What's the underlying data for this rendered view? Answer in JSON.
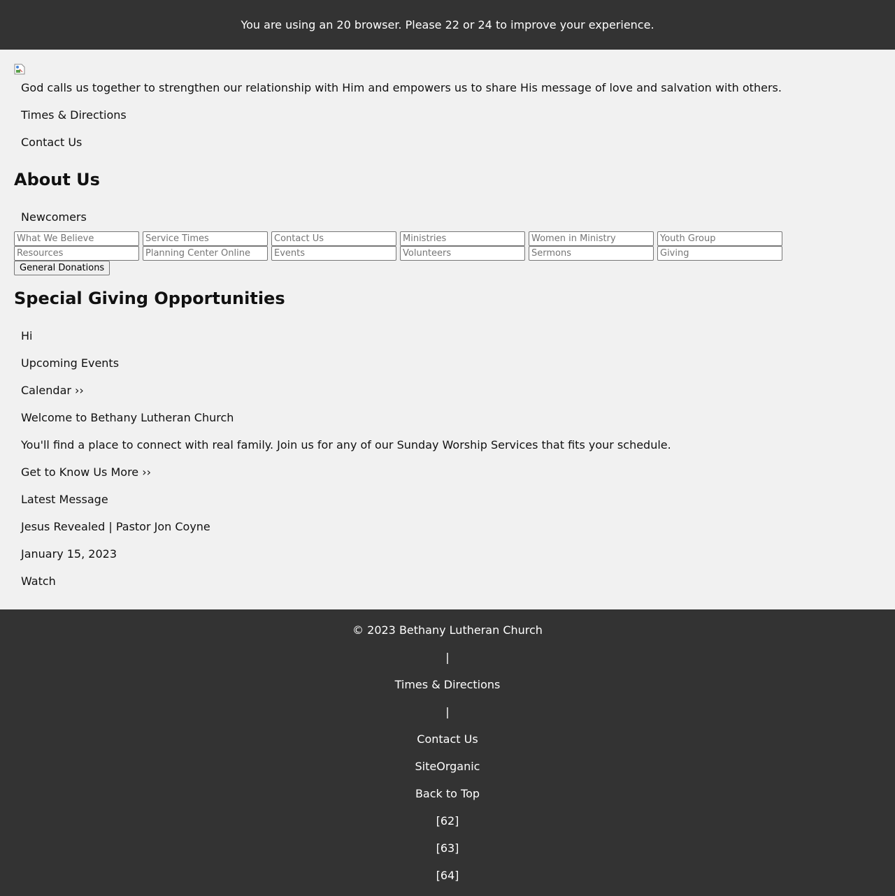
{
  "browser_notice": "You are using an 20 browser. Please 22 or 24 to improve your experience.",
  "logo_image": "broken-image-icon",
  "tagline": "God calls us together to strengthen our relationship with Him and empowers us to share His message of love and salvation with others.",
  "top_links": {
    "times_directions": "Times & Directions",
    "contact_us": "Contact Us"
  },
  "about_heading": "About Us",
  "newcomers": "Newcomers",
  "menu_inputs": [
    "What We Believe",
    "Service Times",
    "Contact Us",
    "Ministries",
    "Women in Ministry",
    "Youth Group",
    "Resources",
    "Planning Center Online",
    "Events",
    "Volunteers",
    "Sermons",
    "Giving"
  ],
  "general_donations_button": "General Donations",
  "special_giving_heading": "Special Giving Opportunities",
  "content": {
    "hi": "Hi",
    "upcoming_events": "Upcoming Events",
    "calendar_link": "Calendar ››",
    "welcome_title": "Welcome to Bethany Lutheran Church",
    "welcome_text": "You'll find a place to connect with real family. Join us for any of our Sunday Worship Services that fits your schedule.",
    "know_us_link": "Get to Know Us More ››",
    "latest_message": "Latest Message",
    "sermon_title": "Jesus Revealed | Pastor Jon Coyne",
    "sermon_date": "January 15, 2023",
    "watch_link": "Watch"
  },
  "footer": {
    "copyright": "© 2023 Bethany Lutheran Church",
    "separator_1": "|",
    "times_directions": "Times & Directions",
    "separator_2": "|",
    "contact_us": "Contact Us",
    "siteorganic": "SiteOrganic",
    "back_to_top": "Back to Top",
    "ref_62": "[62]",
    "ref_63": "[63]",
    "ref_64": "[64]"
  },
  "colors": {
    "bar_background": "#333333",
    "page_background": "#f1f1f1",
    "bar_text": "#ffffff"
  }
}
